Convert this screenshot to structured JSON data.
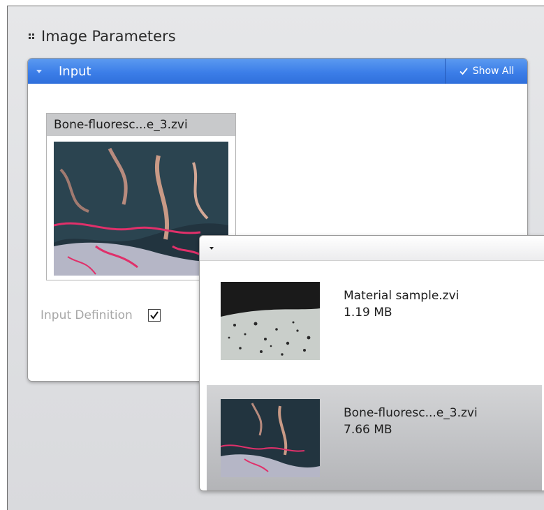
{
  "section": {
    "title": "Image Parameters"
  },
  "panel": {
    "title": "Input",
    "show_all_label": "Show All",
    "selected_image": {
      "name": "Bone-fluoresc...e_3.zvi"
    },
    "input_definition_label": "Input Definition",
    "input_definition_checked": true
  },
  "dropdown": {
    "items": [
      {
        "name": "Material sample.zvi",
        "size": "1.19 MB",
        "selected": false
      },
      {
        "name": "Bone-fluoresc...e_3.zvi",
        "size": "7.66 MB",
        "selected": true
      }
    ]
  },
  "colors": {
    "accent": "#3c7ee8",
    "fluorescence_magenta": "#e0306a",
    "selected_item_bg": "#bfc0c3"
  },
  "icons": {
    "section_grip": "grip-icon",
    "panel_collapse": "caret-down-icon",
    "show_all_check": "check-icon",
    "dropdown_toggle": "caret-down-icon"
  }
}
